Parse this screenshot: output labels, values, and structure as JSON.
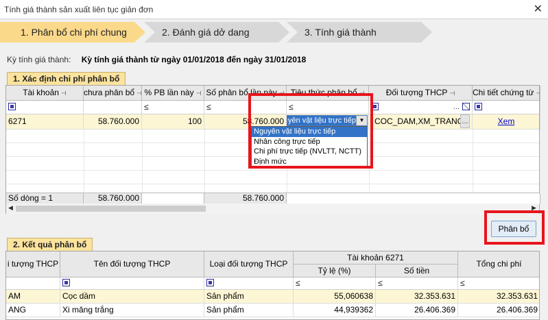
{
  "window": {
    "title": "Tính giá thành sản xuất liên tục giản đơn",
    "close_glyph": "✕"
  },
  "steps": [
    {
      "label": "1. Phân bổ chi phí chung",
      "active": true
    },
    {
      "label": "2. Đánh giá dở dang",
      "active": false
    },
    {
      "label": "3. Tính giá thành",
      "active": false
    }
  ],
  "period": {
    "label": "Kỳ tính giá thành:",
    "value": "Kỳ tính giá thành từ ngày 01/01/2018 đến ngày 31/01/2018"
  },
  "section1": {
    "title": "1. Xác định chi phí phân bổ",
    "columns": [
      "Tài khoản",
      "chưa phân bổ",
      "% PB lần này",
      "Số phân bổ lần này",
      "Tiêu thức phân bổ",
      "Đối tượng THCP",
      "Chi tiết chứng từ"
    ],
    "filter_ops": {
      "le": "≤",
      "ellipsis": "..."
    },
    "row": {
      "account": "6271",
      "unallocated": "58.760.000",
      "percent": "100",
      "amount": "58.760.000",
      "criterion": "Nguyên vật liệu trực tiếp",
      "objects": "COC_DAM,XM_TRANG",
      "detail_link": "Xem"
    },
    "summary": {
      "count": "Số dòng = 1",
      "unallocated": "58.760.000",
      "amount": "58.760.000"
    },
    "dropdown_options": [
      "Nguyên vật liệu trực tiếp",
      "Nhân công trực tiếp",
      "Chi phí trực tiếp (NVLTT, NCTT)",
      "Định mức"
    ],
    "selected_option": 0
  },
  "allocate_button": "Phân bổ",
  "section2": {
    "title": "2. Kết quả phân bổ",
    "columns": {
      "object_code": "i tượng THCP",
      "object_name": "Tên đối tượng THCP",
      "object_type": "Loại đối tượng THCP",
      "account_group": "Tài khoản 6271",
      "ratio": "Tỷ lệ (%)",
      "amount": "Số tiền",
      "total": "Tổng chi phí"
    },
    "rows": [
      {
        "code": "AM",
        "name": "Cọc dầm",
        "type": "Sản phẩm",
        "ratio": "55,060638",
        "amount": "32.353.631",
        "total": "32.353.631"
      },
      {
        "code": "ANG",
        "name": "Xi măng trắng",
        "type": "Sản phẩm",
        "ratio": "44,939362",
        "amount": "26.406.369",
        "total": "26.406.369"
      }
    ]
  },
  "colors": {
    "active_step": "#fbd98a",
    "highlight": "#e8141c",
    "selection": "#3373c7"
  }
}
